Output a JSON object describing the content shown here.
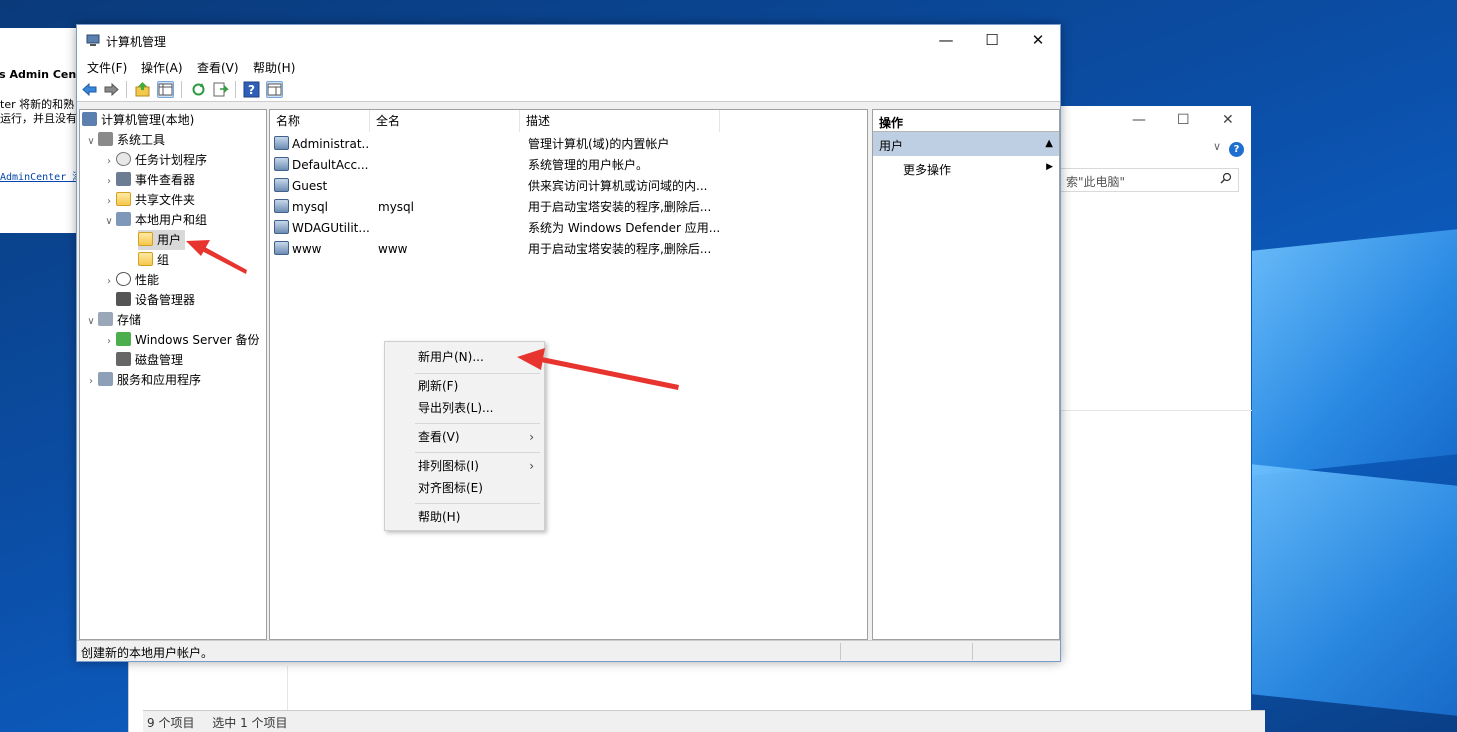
{
  "window": {
    "title": "计算机管理",
    "minimize": "—",
    "maximize": "☐",
    "close": "✕"
  },
  "menubar": {
    "file": "文件(F)",
    "action": "操作(A)",
    "view": "查看(V)",
    "help": "帮助(H)"
  },
  "toolbar": {
    "icons": [
      "back-icon",
      "forward-icon",
      "up-icon",
      "show-hide-tree-icon",
      "refresh-icon",
      "export-icon",
      "help-icon",
      "properties-icon"
    ]
  },
  "tree": {
    "root": "计算机管理(本地)",
    "system_tools": "系统工具",
    "task_scheduler": "任务计划程序",
    "event_viewer": "事件查看器",
    "shared_folders": "共享文件夹",
    "local_users_groups": "本地用户和组",
    "users": "用户",
    "groups": "组",
    "performance": "性能",
    "device_manager": "设备管理器",
    "storage": "存储",
    "windows_server_backup": "Windows Server 备份",
    "disk_management": "磁盘管理",
    "services_apps": "服务和应用程序"
  },
  "list": {
    "columns": [
      "名称",
      "全名",
      "描述"
    ],
    "rows": [
      {
        "name": "Administrat...",
        "fullname": "",
        "desc": "管理计算机(域)的内置帐户"
      },
      {
        "name": "DefaultAcc...",
        "fullname": "",
        "desc": "系统管理的用户帐户。"
      },
      {
        "name": "Guest",
        "fullname": "",
        "desc": "供来宾访问计算机或访问域的内..."
      },
      {
        "name": "mysql",
        "fullname": "mysql",
        "desc": "用于启动宝塔安装的程序,删除后..."
      },
      {
        "name": "WDAGUtilit...",
        "fullname": "",
        "desc": "系统为 Windows Defender 应用..."
      },
      {
        "name": "www",
        "fullname": "www",
        "desc": "用于启动宝塔安装的程序,删除后..."
      }
    ]
  },
  "actions": {
    "header": "操作",
    "section": "用户",
    "more": "更多操作"
  },
  "context_menu": {
    "new_user": "新用户(N)...",
    "refresh": "刷新(F)",
    "export_list": "导出列表(L)...",
    "view": "查看(V)",
    "arrange_icons": "排列图标(I)",
    "align_icons": "对齐图标(E)",
    "help": "帮助(H)",
    "submenu_arrow": "›"
  },
  "status": {
    "text": "创建新的本地用户帐户。"
  },
  "background_admin": {
    "title": "vs Admin Cente",
    "line1": "ter 将新的和熟",
    "line2": "运行，并且没有",
    "link": "AdminCenter 添"
  },
  "background_explorer": {
    "min": "—",
    "max": "☐",
    "close": "✕",
    "chevron": "∨",
    "help": "?",
    "search_placeholder": "索\"此电脑\"",
    "items_count": "9 个项目",
    "selected": "选中 1 个项目"
  },
  "colors": {
    "selection_header": "#bfcfe3",
    "annotation_arrow": "#e8342e",
    "desktop_blue": "#0b4fa8"
  }
}
